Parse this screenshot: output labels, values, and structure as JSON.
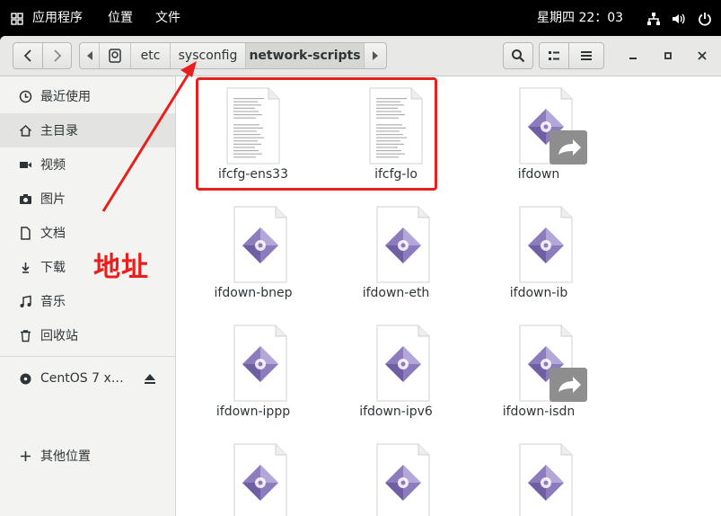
{
  "topbar": {
    "apps_menu": "应用程序",
    "places_menu": "位置",
    "file_menu": "文件",
    "clock": "星期四 22：03"
  },
  "headerbar": {
    "path": [
      "etc",
      "sysconfig",
      "network-scripts"
    ],
    "active_path": "network-scripts"
  },
  "sidebar": {
    "items": [
      {
        "label": "最近使用",
        "icon": "clock-icon"
      },
      {
        "label": "主目录",
        "icon": "home-icon"
      },
      {
        "label": "视频",
        "icon": "video-icon"
      },
      {
        "label": "图片",
        "icon": "camera-icon"
      },
      {
        "label": "文档",
        "icon": "document-icon"
      },
      {
        "label": "下载",
        "icon": "download-icon"
      },
      {
        "label": "音乐",
        "icon": "music-icon"
      },
      {
        "label": "回收站",
        "icon": "trash-icon"
      }
    ],
    "device": "CentOS 7 x…",
    "other": "其他位置"
  },
  "files": [
    {
      "name": "ifcfg-ens33",
      "type": "text"
    },
    {
      "name": "ifcfg-lo",
      "type": "text"
    },
    {
      "name": "ifdown",
      "type": "link"
    },
    {
      "name": "ifdown-bnep",
      "type": "script"
    },
    {
      "name": "ifdown-eth",
      "type": "script"
    },
    {
      "name": "ifdown-ib",
      "type": "script"
    },
    {
      "name": "ifdown-ippp",
      "type": "script"
    },
    {
      "name": "ifdown-ipv6",
      "type": "script"
    },
    {
      "name": "ifdown-isdn",
      "type": "link"
    },
    {
      "name": "",
      "type": "script"
    },
    {
      "name": "",
      "type": "script"
    },
    {
      "name": "",
      "type": "script"
    }
  ],
  "annotation": {
    "label": "地址",
    "color": "#e8201d"
  }
}
